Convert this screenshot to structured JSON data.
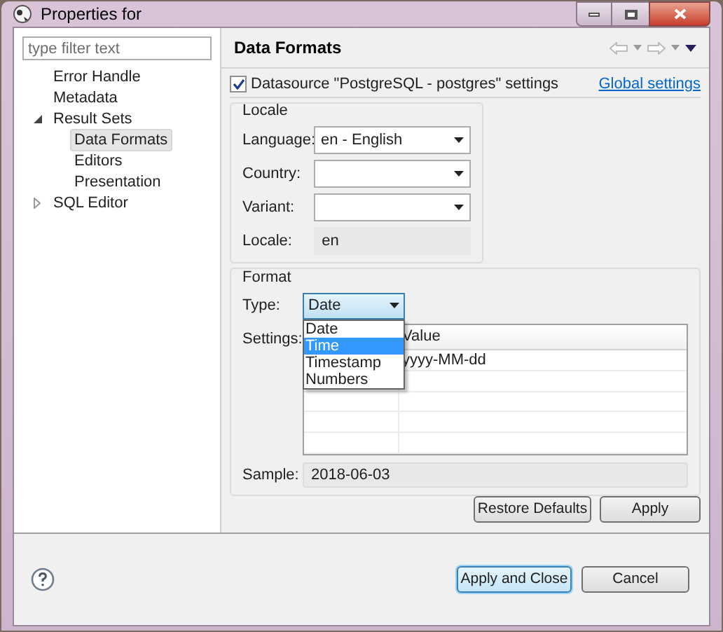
{
  "window": {
    "title": "Properties for"
  },
  "filter": {
    "placeholder": "type filter text"
  },
  "tree": [
    {
      "label": "Error Handle",
      "selected": false
    },
    {
      "label": "Metadata",
      "selected": false
    },
    {
      "label": "Result Sets",
      "selected": false,
      "expanded": true,
      "children": [
        {
          "label": "Data Formats",
          "selected": true
        },
        {
          "label": "Editors",
          "selected": false
        },
        {
          "label": "Presentation",
          "selected": false
        }
      ]
    },
    {
      "label": "SQL Editor",
      "selected": false,
      "expanded": false
    }
  ],
  "page": {
    "title": "Data Formats",
    "datasource": {
      "label": "Datasource \"PostgreSQL - postgres\" settings",
      "checked": true
    },
    "global_link": "Global settings",
    "locale": {
      "title": "Locale",
      "fields": [
        {
          "label": "Language:",
          "value": "en - English",
          "kind": "combo"
        },
        {
          "label": "Country:",
          "kind": "combo"
        },
        {
          "label": "Variant:",
          "kind": "combo"
        },
        {
          "label": "Locale:",
          "value": "en",
          "kind": "readonly"
        }
      ]
    },
    "format": {
      "title": "Format",
      "type_label": "Type:",
      "type_value": "Date",
      "type_options": [
        {
          "label": "Date",
          "selected": false
        },
        {
          "label": "Time",
          "selected": true
        },
        {
          "label": "Timestamp",
          "selected": false
        },
        {
          "label": "Numbers",
          "selected": false
        }
      ],
      "settings_label": "Settings:",
      "table": {
        "value_header": "Value",
        "rows": [
          {
            "value": "yyyy-MM-dd"
          }
        ]
      },
      "sample_label": "Sample:",
      "sample_value": "2018-06-03"
    },
    "buttons": [
      {
        "label": "Restore Defaults"
      },
      {
        "label": "Apply"
      }
    ]
  },
  "footer_buttons": [
    {
      "label": "Apply and Close",
      "default": true
    },
    {
      "label": "Cancel",
      "default": false
    }
  ]
}
